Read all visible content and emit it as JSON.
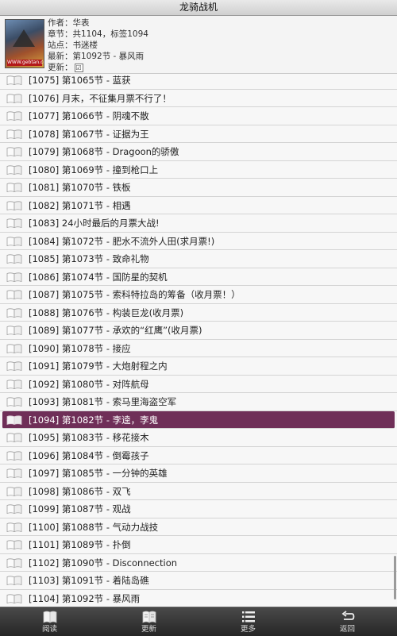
{
  "app": {
    "title": "龙骑战机"
  },
  "book": {
    "author_label": "作者：",
    "author": "华表",
    "chapters_label": "章节：",
    "chapters": "共1104，标签1094",
    "site_label": "站点：",
    "site": "书迷楼",
    "latest_label": "最新：",
    "latest": "第1092节 - 暴风雨",
    "update_label": "更新：",
    "update_checked": "☑",
    "cover_text": "WWW.gebtan.com"
  },
  "chapters": [
    {
      "num": "[1075]",
      "title": "第1065节 - 蓝获"
    },
    {
      "num": "[1076]",
      "title": "月末，不征集月票不行了！"
    },
    {
      "num": "[1077]",
      "title": "第1066节 - 阴魂不散"
    },
    {
      "num": "[1078]",
      "title": "第1067节 - 证据为王"
    },
    {
      "num": "[1079]",
      "title": "第1068节 - Dragoon的骄傲"
    },
    {
      "num": "[1080]",
      "title": "第1069节 - 撞到枪口上"
    },
    {
      "num": "[1081]",
      "title": "第1070节 - 铁板"
    },
    {
      "num": "[1082]",
      "title": "第1071节 - 相遇"
    },
    {
      "num": "[1083]",
      "title": "24小时最后的月票大战!"
    },
    {
      "num": "[1084]",
      "title": "第1072节 - 肥水不流外人田(求月票!)"
    },
    {
      "num": "[1085]",
      "title": "第1073节 - 致命礼物"
    },
    {
      "num": "[1086]",
      "title": "第1074节 - 国防星的契机"
    },
    {
      "num": "[1087]",
      "title": "第1075节 - 索科特拉岛的筹备（收月票！）"
    },
    {
      "num": "[1088]",
      "title": "第1076节 - 构装巨龙(收月票)"
    },
    {
      "num": "[1089]",
      "title": "第1077节 - 承欢的“红鹰”(收月票)"
    },
    {
      "num": "[1090]",
      "title": "第1078节 - 接应"
    },
    {
      "num": "[1091]",
      "title": "第1079节 - 大炮射程之内"
    },
    {
      "num": "[1092]",
      "title": "第1080节 - 对阵航母"
    },
    {
      "num": "[1093]",
      "title": "第1081节 - 索马里海盗空军"
    },
    {
      "num": "[1094]",
      "title": "第1082节 - 李逵，李鬼"
    },
    {
      "num": "[1095]",
      "title": "第1083节 - 移花接木"
    },
    {
      "num": "[1096]",
      "title": "第1084节 - 倒霉孩子"
    },
    {
      "num": "[1097]",
      "title": "第1085节 - 一分钟的英雄"
    },
    {
      "num": "[1098]",
      "title": "第1086节 - 双飞"
    },
    {
      "num": "[1099]",
      "title": "第1087节 - 观战"
    },
    {
      "num": "[1100]",
      "title": "第1088节 - 气动力战技"
    },
    {
      "num": "[1101]",
      "title": "第1089节 - 扑倒"
    },
    {
      "num": "[1102]",
      "title": "第1090节 - Disconnection"
    },
    {
      "num": "[1103]",
      "title": "第1091节 - 着陆岛礁"
    },
    {
      "num": "[1104]",
      "title": "第1092节 - 暴风雨"
    }
  ],
  "selected_index": 19,
  "colors": {
    "selected_bg": "#6f2f58",
    "bottom_bar": "#333333"
  },
  "bottom_bar": {
    "read_label": "阅读",
    "update_label": "更新",
    "more_label": "更多",
    "back_label": "返回"
  }
}
